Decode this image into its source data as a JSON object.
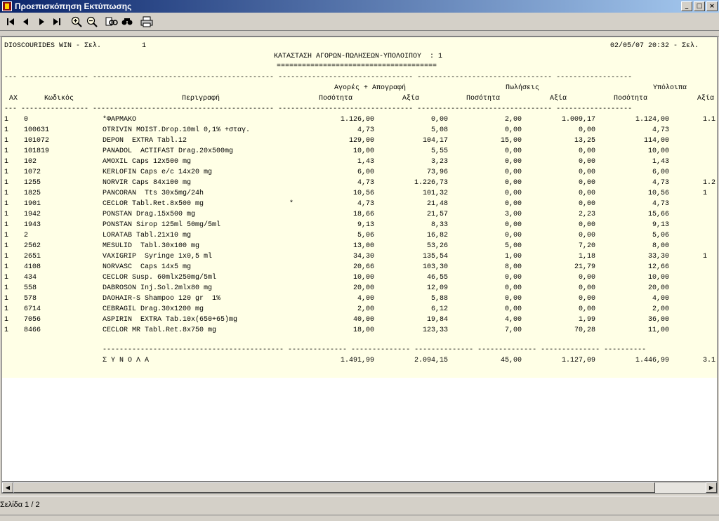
{
  "window": {
    "title": "Προεπισκόπηση Εκτύπωσης",
    "buttons": {
      "minimize": "_",
      "maximize": "□",
      "close": "×"
    }
  },
  "toolbar": {
    "icons": [
      "first-page-icon",
      "prev-page-icon",
      "next-page-icon",
      "last-page-icon",
      "zoom-in-icon",
      "zoom-out-icon",
      "find-icon",
      "find-next-icon",
      "print-icon"
    ]
  },
  "report": {
    "header_left": "DIOSCOURIDES WIN - Σελ.",
    "page_number": "1",
    "header_right": "02/05/07 20:32 - Σελ.",
    "title": "ΚΑΤΑΣΤΑΣΗ ΑΓΟΡΩΝ-ΠΩΛΗΣΕΩΝ-ΥΠΟΛΟΙΠΟΥ  : 1",
    "title_underline": "======================================",
    "group_headers": {
      "purchases": "Αγορές + Απογραφή",
      "sales": "Πωλήσεις",
      "balances": "Υπόλοιπα"
    },
    "columns": {
      "ax": "ΑΧ",
      "code": "Κωδικός",
      "description": "Περιγραφή",
      "p_qty": "Ποσότητα",
      "p_val": "Αξία",
      "s_qty": "Ποσότητα",
      "s_val": "Αξία",
      "b_qty": "Ποσότητα",
      "b_val": "Αξία"
    },
    "rows": [
      {
        "ax": "1",
        "code": "0",
        "desc": "*ΦΑΡΜΑΚΟ",
        "mark": "",
        "p_qty": "1.126,00",
        "p_val": "0,00",
        "s_qty": "2,00",
        "s_val": "1.009,17",
        "b_qty": "1.124,00",
        "b_val": "1.1"
      },
      {
        "ax": "1",
        "code": "100631",
        "desc": "OTRIVIN MOIST.Drop.10ml 0,1% +σταγ.",
        "mark": "",
        "p_qty": "4,73",
        "p_val": "5,08",
        "s_qty": "0,00",
        "s_val": "0,00",
        "b_qty": "4,73",
        "b_val": ""
      },
      {
        "ax": "1",
        "code": "101072",
        "desc": "DEPON  EXTRA Tabl.12",
        "mark": "",
        "p_qty": "129,00",
        "p_val": "104,17",
        "s_qty": "15,00",
        "s_val": "13,25",
        "b_qty": "114,00",
        "b_val": ""
      },
      {
        "ax": "1",
        "code": "101819",
        "desc": "PANADOL  ACTIFAST Drag.20x500mg",
        "mark": "",
        "p_qty": "10,00",
        "p_val": "5,55",
        "s_qty": "0,00",
        "s_val": "0,00",
        "b_qty": "10,00",
        "b_val": ""
      },
      {
        "ax": "1",
        "code": "102",
        "desc": "AMOXIL Caps 12x500 mg",
        "mark": "",
        "p_qty": "1,43",
        "p_val": "3,23",
        "s_qty": "0,00",
        "s_val": "0,00",
        "b_qty": "1,43",
        "b_val": ""
      },
      {
        "ax": "1",
        "code": "1072",
        "desc": "KERLOFIN Caps e/c 14x20 mg",
        "mark": "",
        "p_qty": "6,00",
        "p_val": "73,96",
        "s_qty": "0,00",
        "s_val": "0,00",
        "b_qty": "6,00",
        "b_val": ""
      },
      {
        "ax": "1",
        "code": "1255",
        "desc": "NORVIR Caps 84x100 mg",
        "mark": "",
        "p_qty": "4,73",
        "p_val": "1.226,73",
        "s_qty": "0,00",
        "s_val": "0,00",
        "b_qty": "4,73",
        "b_val": "1.2"
      },
      {
        "ax": "1",
        "code": "1825",
        "desc": "PANCORAN  Tts 30x5mg/24h",
        "mark": "",
        "p_qty": "10,56",
        "p_val": "101,32",
        "s_qty": "0,00",
        "s_val": "0,00",
        "b_qty": "10,56",
        "b_val": "1"
      },
      {
        "ax": "1",
        "code": "1901",
        "desc": "CECLOR Tabl.Ret.8x500 mg",
        "mark": "*",
        "p_qty": "4,73",
        "p_val": "21,48",
        "s_qty": "0,00",
        "s_val": "0,00",
        "b_qty": "4,73",
        "b_val": ""
      },
      {
        "ax": "1",
        "code": "1942",
        "desc": "PONSTAN Drag.15x500 mg",
        "mark": "",
        "p_qty": "18,66",
        "p_val": "21,57",
        "s_qty": "3,00",
        "s_val": "2,23",
        "b_qty": "15,66",
        "b_val": ""
      },
      {
        "ax": "1",
        "code": "1943",
        "desc": "PONSTAN Sirop 125ml 50mg/5ml",
        "mark": "",
        "p_qty": "9,13",
        "p_val": "8,33",
        "s_qty": "0,00",
        "s_val": "0,00",
        "b_qty": "9,13",
        "b_val": ""
      },
      {
        "ax": "1",
        "code": "2",
        "desc": "LORATAB Tabl.21x10 mg",
        "mark": "",
        "p_qty": "5,06",
        "p_val": "16,82",
        "s_qty": "0,00",
        "s_val": "0,00",
        "b_qty": "5,06",
        "b_val": ""
      },
      {
        "ax": "1",
        "code": "2562",
        "desc": "MESULID  Tabl.30x100 mg",
        "mark": "",
        "p_qty": "13,00",
        "p_val": "53,26",
        "s_qty": "5,00",
        "s_val": "7,20",
        "b_qty": "8,00",
        "b_val": ""
      },
      {
        "ax": "1",
        "code": "2651",
        "desc": "VAXIGRIP  Syringe 1x0,5 ml",
        "mark": "",
        "p_qty": "34,30",
        "p_val": "135,54",
        "s_qty": "1,00",
        "s_val": "1,18",
        "b_qty": "33,30",
        "b_val": "1"
      },
      {
        "ax": "1",
        "code": "4108",
        "desc": "NORVASC  Caps 14x5 mg",
        "mark": "",
        "p_qty": "20,66",
        "p_val": "103,30",
        "s_qty": "8,00",
        "s_val": "21,79",
        "b_qty": "12,66",
        "b_val": ""
      },
      {
        "ax": "1",
        "code": "434",
        "desc": "CECLOR Susp. 60mlx250mg/5ml",
        "mark": "",
        "p_qty": "10,00",
        "p_val": "46,55",
        "s_qty": "0,00",
        "s_val": "0,00",
        "b_qty": "10,00",
        "b_val": ""
      },
      {
        "ax": "1",
        "code": "558",
        "desc": "DABROSON Inj.Sol.2mlx80 mg",
        "mark": "",
        "p_qty": "20,00",
        "p_val": "12,09",
        "s_qty": "0,00",
        "s_val": "0,00",
        "b_qty": "20,00",
        "b_val": ""
      },
      {
        "ax": "1",
        "code": "578",
        "desc": "DAOHAIR-S Shampoo 120 gr  1%",
        "mark": "",
        "p_qty": "4,00",
        "p_val": "5,88",
        "s_qty": "0,00",
        "s_val": "0,00",
        "b_qty": "4,00",
        "b_val": ""
      },
      {
        "ax": "1",
        "code": "6714",
        "desc": "CEBRAGIL Drag.30x1200 mg",
        "mark": "",
        "p_qty": "2,00",
        "p_val": "6,12",
        "s_qty": "0,00",
        "s_val": "0,00",
        "b_qty": "2,00",
        "b_val": ""
      },
      {
        "ax": "1",
        "code": "7056",
        "desc": "ASPIRIN  EXTRA Tab.10x(650+65)mg",
        "mark": "",
        "p_qty": "40,00",
        "p_val": "19,84",
        "s_qty": "4,00",
        "s_val": "1,99",
        "b_qty": "36,00",
        "b_val": ""
      },
      {
        "ax": "1",
        "code": "8466",
        "desc": "CECLOR MR Tabl.Ret.8x750 mg",
        "mark": "",
        "p_qty": "18,00",
        "p_val": "123,33",
        "s_qty": "7,00",
        "s_val": "70,28",
        "b_qty": "11,00",
        "b_val": ""
      }
    ],
    "totals": {
      "label": "Σ Υ Ν Ο Λ Α",
      "p_qty": "1.491,99",
      "p_val": "2.094,15",
      "s_qty": "45,00",
      "s_val": "1.127,09",
      "b_qty": "1.446,99",
      "b_val": "3.1"
    }
  },
  "status": {
    "page_indicator": "Σελίδα 1 / 2"
  }
}
